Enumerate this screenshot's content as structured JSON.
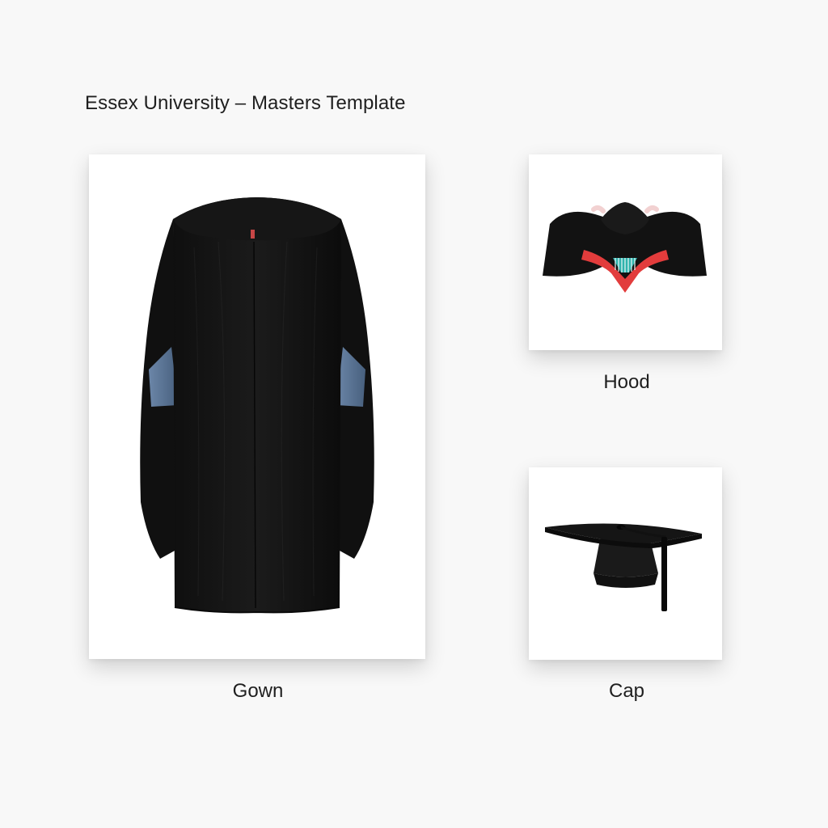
{
  "page": {
    "title": "Essex University – Masters Template"
  },
  "items": [
    {
      "key": "gown",
      "label": "Gown",
      "icon": "gown-icon"
    },
    {
      "key": "hood",
      "label": "Hood",
      "icon": "hood-icon"
    },
    {
      "key": "cap",
      "label": "Cap",
      "icon": "cap-icon"
    }
  ],
  "colors": {
    "background": "#f8f8f8",
    "card": "#ffffff",
    "fabric": "#121212",
    "sleeve_lining": "#5a7698",
    "hood_trim": "#e23c3c",
    "hood_lining": "#2fb3ad",
    "hood_shoulder_accent": "#f2d1d1"
  }
}
